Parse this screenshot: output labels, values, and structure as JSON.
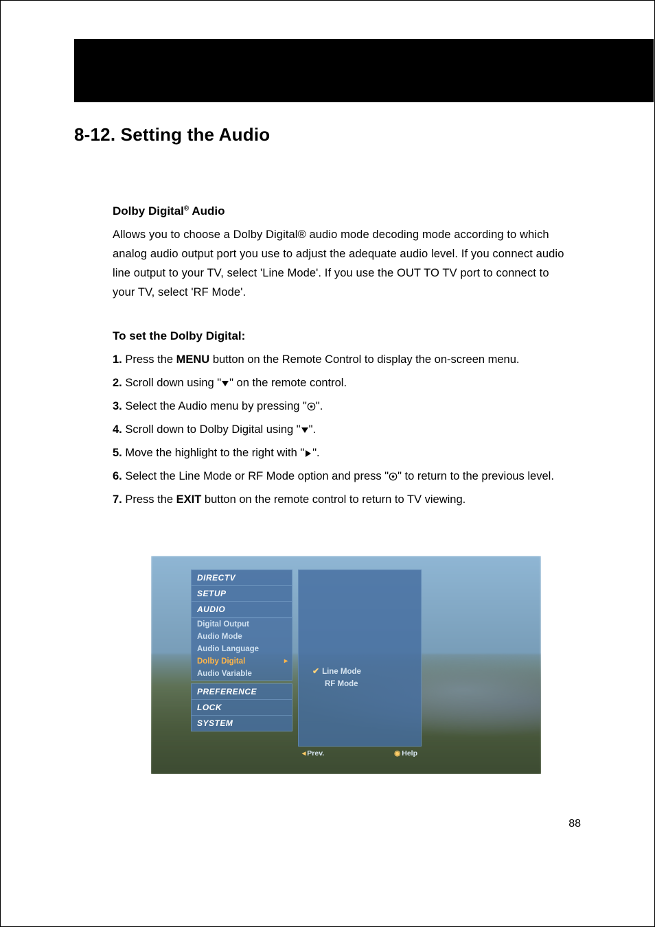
{
  "heading": "8-12. Setting the Audio",
  "sub1_title_pre": "Dolby Digital",
  "sub1_title_suf": " Audio",
  "sub1_reg": "®",
  "body1": "Allows you to choose a Dolby Digital® audio mode decoding mode according to which analog audio output port you use to adjust the adequate audio level. If you connect audio line output to your TV, select 'Line Mode'. If you use the OUT TO TV port to connect to your TV, select 'RF Mode'.",
  "sub2_title": "To set the Dolby Digital:",
  "steps": {
    "s1_num": "1.",
    "s1_a": " Press the ",
    "s1_bold": "MENU",
    "s1_b": " button on the Remote Control to display the on-screen menu.",
    "s2_num": "2.",
    "s2_a": " Scroll down using \"",
    "s2_b": "\" on the remote control.",
    "s3_num": "3.",
    "s3_a": " Select the Audio menu by pressing \"",
    "s3_b": "\".",
    "s4_num": "4.",
    "s4_a": " Scroll down to Dolby Digital using \"",
    "s4_b": "\".",
    "s5_num": "5.",
    "s5_a": " Move the highlight to the right with \"",
    "s5_b": "\".",
    "s6_num": "6.",
    "s6_a": " Select the Line Mode or RF Mode option and press \"",
    "s6_b": "\" to return to the previous level.",
    "s7_num": "7.",
    "s7_a": " Press the ",
    "s7_bold": "EXIT",
    "s7_b": " button on the remote control to return to TV viewing."
  },
  "osd": {
    "brand": "DIRECTV",
    "setup": "SETUP",
    "audio": "AUDIO",
    "items": {
      "i0": "Digital Output",
      "i1": "Audio Mode",
      "i2": "Audio Language",
      "i3": "Dolby Digital",
      "i4": "Audio Variable"
    },
    "pref": "PREFERENCE",
    "lock": "LOCK",
    "system": "SYSTEM",
    "opt1": "Line Mode",
    "opt2": "RF Mode",
    "check": "✔",
    "prev_icon": "◂",
    "prev": "Prev.",
    "help_icon": "◉",
    "help": "Help"
  },
  "page_number": "88"
}
